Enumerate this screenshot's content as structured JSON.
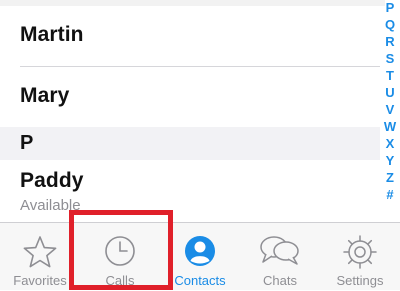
{
  "contacts": [
    {
      "name": "Martin",
      "status": ""
    },
    {
      "name": "Mary",
      "status": ""
    },
    {
      "name": "Paddy",
      "status": "Available"
    }
  ],
  "section_header": "P",
  "index_letters": [
    "P",
    "Q",
    "R",
    "S",
    "T",
    "U",
    "V",
    "W",
    "X",
    "Y",
    "Z",
    "#"
  ],
  "tabs": [
    {
      "label": "Favorites",
      "icon": "star-icon",
      "active": false
    },
    {
      "label": "Calls",
      "icon": "clock-icon",
      "active": false
    },
    {
      "label": "Contacts",
      "icon": "person-icon",
      "active": true
    },
    {
      "label": "Chats",
      "icon": "speech-bubbles-icon",
      "active": false
    },
    {
      "label": "Settings",
      "icon": "gear-icon",
      "active": false
    }
  ],
  "colors": {
    "accent": "#1a8ce6",
    "inactive": "#8e8e93",
    "highlight": "#e0202a"
  }
}
